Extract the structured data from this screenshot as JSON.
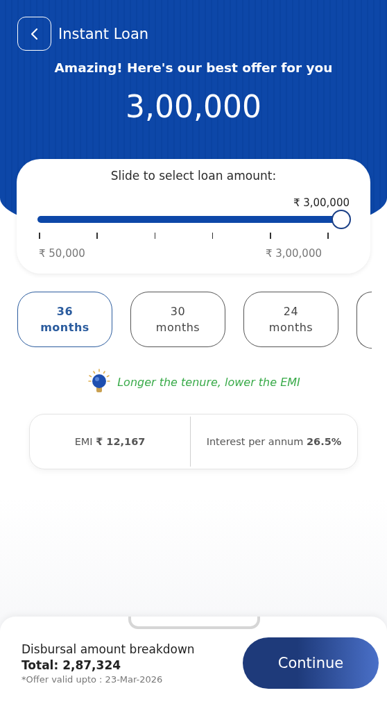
{
  "header": {
    "title": "Instant Loan",
    "headline": "Amazing! Here's our best offer for you",
    "amount": "3,00,000"
  },
  "slider": {
    "label": "Slide to select loan amount:",
    "value": "₹ 3,00,000",
    "level": 1,
    "min_label": "₹ 50,000",
    "max_label": "₹ 3,00,000"
  },
  "tenures": [
    {
      "number": "36",
      "unit": "months",
      "selected": true
    },
    {
      "number": "30",
      "unit": "months",
      "selected": false
    },
    {
      "number": "24",
      "unit": "months",
      "selected": false
    }
  ],
  "tip": "Longer the tenure, lower the EMI",
  "summary": {
    "emi": "EMI **₹ 12,167**",
    "interest": "Interest per annum **26.5%**"
  },
  "footer": {
    "title": "Disbursal amount breakdown",
    "total": "Total: 2,87,324",
    "validity": "*Offer valid upto : 23-Mar-2026",
    "button": "Continue"
  }
}
